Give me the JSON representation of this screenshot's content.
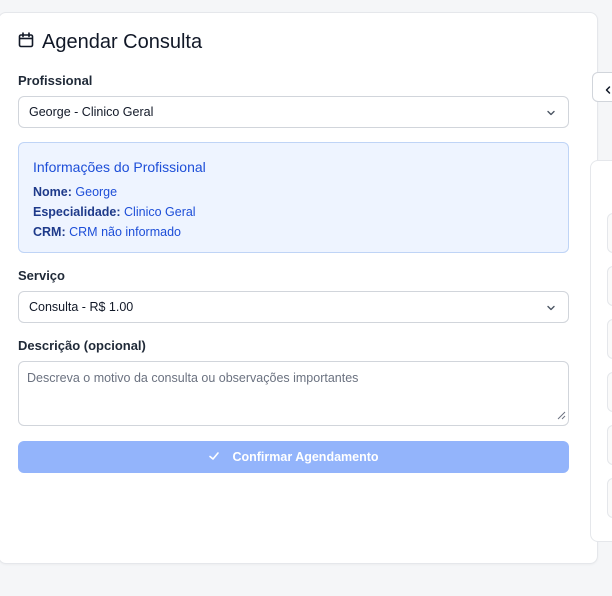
{
  "form": {
    "title": "Agendar Consulta",
    "profissional_label": "Profissional",
    "profissional_value": "George - Clinico Geral",
    "info": {
      "heading": "Informações do Profissional",
      "nome_label": "Nome:",
      "nome_value": "George",
      "especialidade_label": "Especialidade:",
      "especialidade_value": "Clinico Geral",
      "crm_label": "CRM:",
      "crm_value": "CRM não informado"
    },
    "servico_label": "Serviço",
    "servico_value": "Consulta - R$ 1.00",
    "descricao_label": "Descrição (opcional)",
    "descricao_placeholder": "Descreva o motivo da consulta ou observações importantes",
    "confirm_label": "Confirmar Agendamento"
  },
  "icons": {
    "title": "calendar-icon",
    "select": "chevron-down-icon",
    "confirm": "check-icon",
    "side": "chevron-left-icon"
  },
  "colors": {
    "accent_button": "#93b4fb",
    "info_bg": "#eef4ff",
    "info_text": "#1d4ed8"
  }
}
